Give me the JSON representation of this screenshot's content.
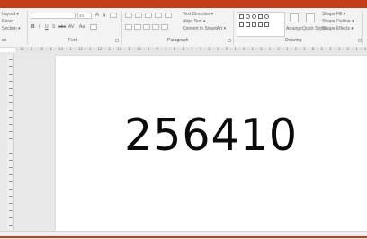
{
  "ribbon": {
    "slides_group": {
      "layout_label": "Layout ▾",
      "reset_label": "Reset",
      "section_label": "Section ▾",
      "group_label": "es"
    },
    "font_group": {
      "size_value": "24",
      "group_label": "Font",
      "bold": "B",
      "italic": "I",
      "underline": "U",
      "shadow": "S",
      "strike": "abc",
      "spacing": "AV",
      "case": "Aa",
      "grow": "A",
      "shrink": "A"
    },
    "paragraph_group": {
      "text_direction_label": "Text Direction ▾",
      "align_text_label": "Align Text ▾",
      "convert_smartart_label": "Convert to SmartArt ▾",
      "group_label": "Paragraph"
    },
    "drawing_group": {
      "arrange_label": "Arrange",
      "quick_styles_label": "Quick Styles",
      "shape_fill_label": "Shape Fill ▾",
      "shape_outline_label": "Shape Outline ▾",
      "shape_effects_label": "Shape Effects ▾",
      "group_label": "Drawing"
    }
  },
  "ruler": {
    "horizontal_text": "· 16 · 1 · 15 · 1 · 14 · 1 · 13 · 1 · 12 · 1 · 11 · 1 · 10 · 1 · 9 · 1 · 8 · 1 · 7 · 1 · 6 · 1 · 5 · 1 · 4 · 1 · 3 · 1 · 2 · 1 · 1 · 1 · 0 · 1 · 1 · 1 · 2 · 1 · 3 · 1 · 4 · 1 · 5 · 1 · 6 · 1 · 7 · 1 · 8 · 1 · 9 · 1 · 10 · 1 · 11 · 1 · 12 ·"
  },
  "slide": {
    "text": "256410"
  },
  "colors": {
    "accent": "#c43e1c",
    "ribbon_bg": "#f3f3f3",
    "workspace_bg": "#e8e8e8"
  },
  "icons": [
    "shapes-gallery-icon",
    "arrange-icon",
    "quick-styles-icon",
    "launcher-icon"
  ]
}
